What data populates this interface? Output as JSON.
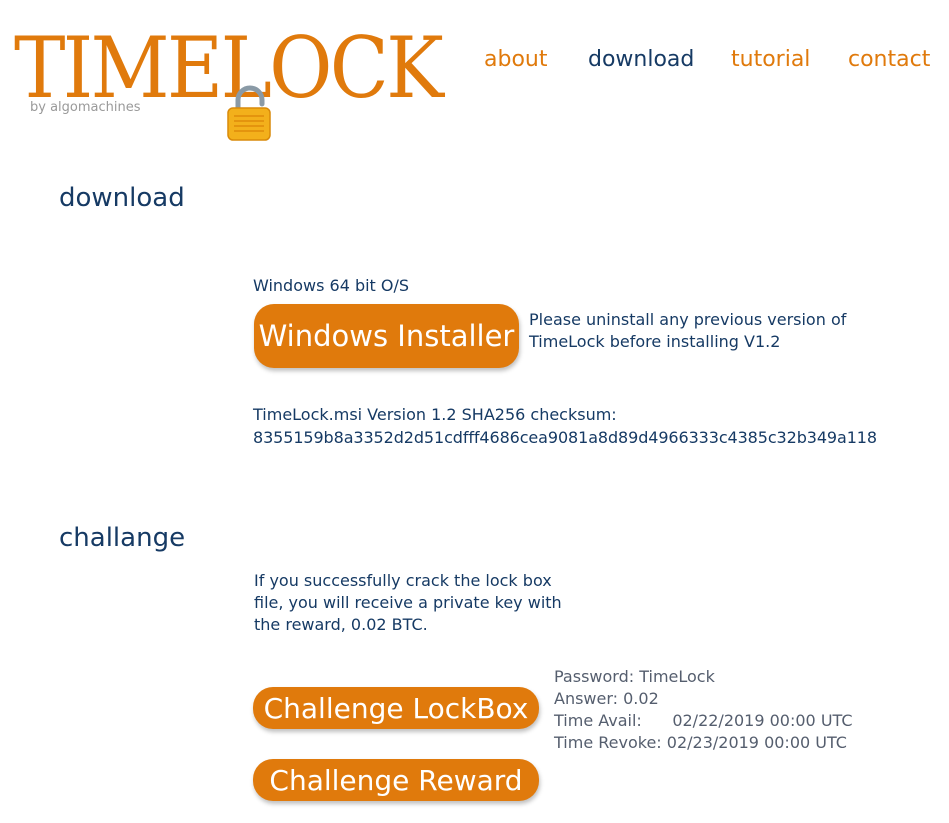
{
  "logo": {
    "wordmark": "TIMELOCK",
    "tagline": "by algomachines"
  },
  "nav": [
    {
      "label": "about",
      "active": false
    },
    {
      "label": "download",
      "active": true
    },
    {
      "label": "tutorial",
      "active": false
    },
    {
      "label": "contact",
      "active": false
    }
  ],
  "download": {
    "title": "download",
    "os_label": "Windows 64 bit O/S",
    "installer_button": "Windows Installer",
    "uninstall_note": "Please uninstall any previous version of TimeLock before installing V1.2",
    "checksum_label": "TimeLock.msi Version 1.2 SHA256 checksum:",
    "checksum_value": "8355159b8a3352d2d51cdfff4686cea9081a8d89d4966333c4385c32b349a118"
  },
  "challange": {
    "title": "challange",
    "description": "If you successfully crack the lock box file, you will receive a private key with the reward, 0.02 BTC.",
    "lockbox_button": "Challenge LockBox",
    "reward_button": "Challenge Reward",
    "info": {
      "password": "Password: TimeLock",
      "answer": "Answer: 0.02",
      "time_avail": "Time Avail:      02/22/2019 00:00 UTC",
      "time_revoke": "Time Revoke: 02/23/2019 00:00 UTC"
    }
  },
  "colors": {
    "accent": "#e07a0c",
    "text": "#163a64",
    "muted": "#9a9a9a"
  }
}
